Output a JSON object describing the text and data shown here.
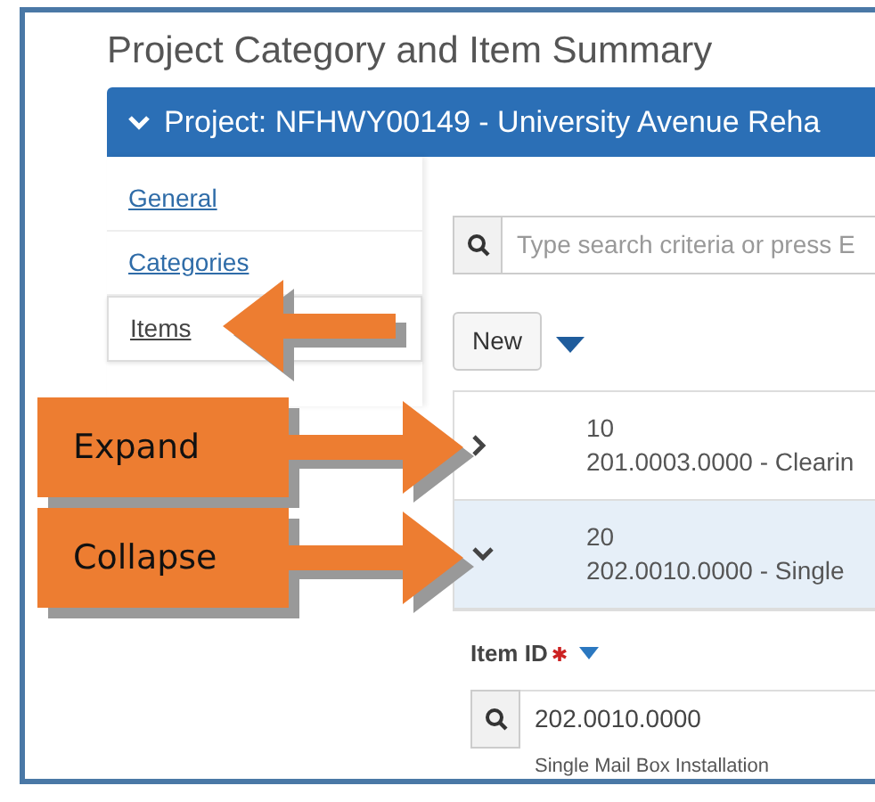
{
  "title": "Project Category and Item Summary",
  "project_bar": {
    "label": "Project: NFHWY00149 - University Avenue Reha",
    "expanded": true
  },
  "sidebar": {
    "items": [
      {
        "label": "General",
        "selected": false
      },
      {
        "label": "Categories",
        "selected": false
      },
      {
        "label": "Items",
        "selected": true
      }
    ]
  },
  "search": {
    "placeholder": "Type search criteria or press E"
  },
  "new_button": "New",
  "rows": [
    {
      "number": "10",
      "description": "201.0003.0000 - Clearin",
      "expanded": false
    },
    {
      "number": "20",
      "description": "202.0010.0000 - Single",
      "expanded": true
    }
  ],
  "detail": {
    "label": "Item ID",
    "required": true,
    "value": "202.0010.0000",
    "hint": "Single Mail Box Installation"
  },
  "callouts": [
    {
      "label": "Expand"
    },
    {
      "label": "Collapse"
    }
  ]
}
